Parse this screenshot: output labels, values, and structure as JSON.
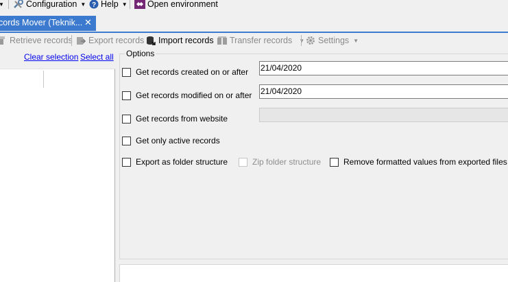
{
  "menubar": {
    "configuration": "Configuration",
    "help": "Help",
    "open_environment": "Open environment"
  },
  "tab": {
    "title": "cords Mover (Teknik...",
    "close": "✕"
  },
  "toolbar": {
    "retrieve": "Retrieve records",
    "export": "Export records",
    "import": "Import records",
    "transfer": "Transfer records",
    "settings": "Settings"
  },
  "left": {
    "clear_selection": "Clear selection",
    "select_all": "Select all"
  },
  "options": {
    "legend": "Options",
    "created_after": "Get records created on or after",
    "created_date": "21/04/2020",
    "modified_after": "Get records modified on or after",
    "modified_date": "21/04/2020",
    "from_website": "Get records from website",
    "only_active": "Get only active records",
    "folder_structure": "Export as folder structure",
    "zip_folder": "Zip folder structure",
    "remove_formatted": "Remove formatted values from exported files"
  },
  "colors": {
    "accent": "#3c7ad0",
    "link": "#0000ee",
    "disabled_text": "#8a8a8a"
  }
}
